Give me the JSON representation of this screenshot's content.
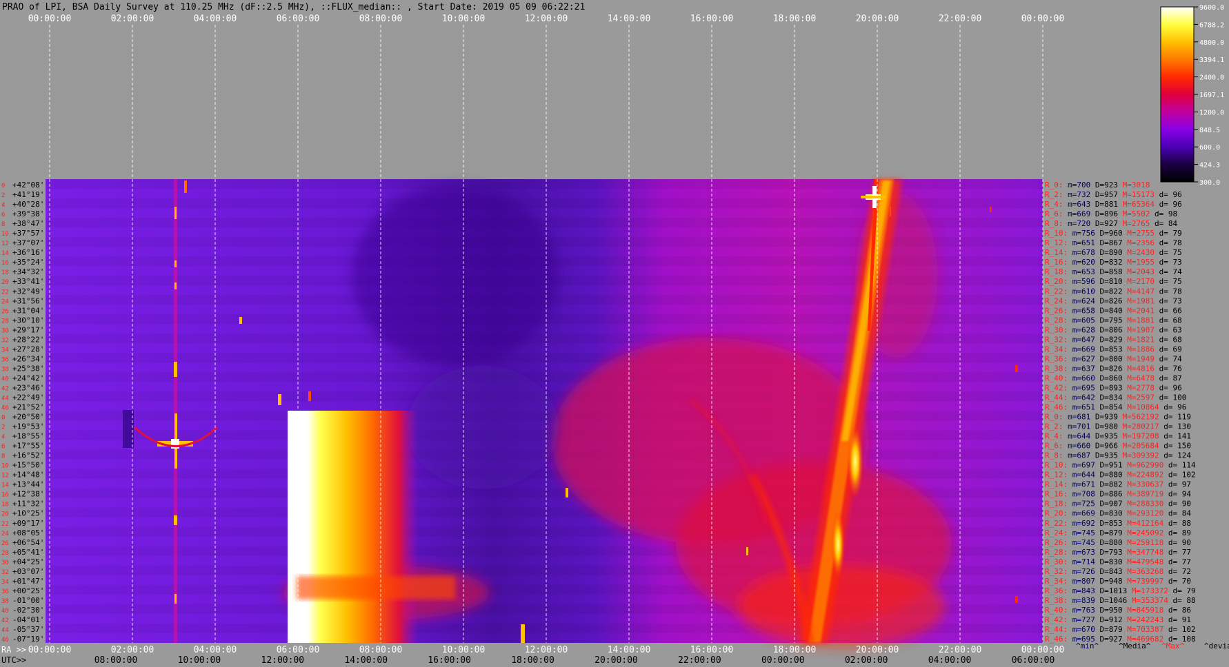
{
  "title": "PRAO of LPI, BSA Daily Survey at 110.25 MHz (dF::2.5 MHz), ::FLUX_median:: , Start Date: 2019 05 09 06:22:21",
  "chart_data": {
    "type": "heatmap",
    "title": "PRAO of LPI, BSA Daily Survey at 110.25 MHz (dF::2.5 MHz), ::FLUX_median:: , Start Date: 2019 05 09 06:22:21",
    "top_axis_ticks": [
      "00:00:00",
      "02:00:00",
      "04:00:00",
      "06:00:00",
      "08:00:00",
      "10:00:00",
      "12:00:00",
      "14:00:00",
      "16:00:00",
      "18:00:00",
      "20:00:00",
      "22:00:00",
      "00:00:00"
    ],
    "ra_axis_label": "RA >>",
    "ra_ticks": [
      "00:00:00",
      "02:00:00",
      "04:00:00",
      "06:00:00",
      "08:00:00",
      "10:00:00",
      "12:00:00",
      "14:00:00",
      "16:00:00",
      "18:00:00",
      "20:00:00",
      "22:00:00",
      "00:00:00"
    ],
    "utc_axis_label": "UTC>>",
    "utc_ticks": [
      "08:00:00",
      "10:00:00",
      "12:00:00",
      "14:00:00",
      "16:00:00",
      "18:00:00",
      "20:00:00",
      "22:00:00",
      "00:00:00",
      "02:00:00",
      "04:00:00",
      "06:00:00"
    ],
    "colorbar": {
      "ticks": [
        "9600.0",
        "6788.2",
        "4800.0",
        "3394.1",
        "2400.0",
        "1697.1",
        "1200.0",
        "848.5",
        "600.0",
        "424.3",
        "300.0"
      ],
      "range": [
        300,
        9600
      ],
      "scale": "log",
      "colors": [
        "#000000",
        "#1a0040",
        "#4b00b4",
        "#8a00e6",
        "#c000a0",
        "#e0003c",
        "#ff2a00",
        "#ff7a00",
        "#ffc000",
        "#ffff40",
        "#ffffff"
      ]
    },
    "row_indices": [
      "0",
      "2",
      "4",
      "6",
      "8",
      "10",
      "12",
      "14",
      "16",
      "18",
      "20",
      "22",
      "24",
      "26",
      "28",
      "30",
      "32",
      "34",
      "36",
      "38",
      "40",
      "42",
      "44",
      "46",
      "0",
      "2",
      "4",
      "6",
      "8",
      "10",
      "12",
      "14",
      "16",
      "18",
      "20",
      "22",
      "24",
      "26",
      "28",
      "30",
      "32",
      "34",
      "36",
      "38",
      "40",
      "42",
      "44",
      "46"
    ],
    "declinations": [
      "+42°08'",
      "+41°19'",
      "+40°28'",
      "+39°38'",
      "+38°47'",
      "+37°57'",
      "+37°07'",
      "+36°16'",
      "+35°24'",
      "+34°32'",
      "+33°41'",
      "+32°49'",
      "+31°56'",
      "+31°04'",
      "+30°10'",
      "+29°17'",
      "+28°22'",
      "+27°28'",
      "+26°34'",
      "+25°38'",
      "+24°42'",
      "+23°46'",
      "+22°49'",
      "+21°52'",
      "+20°50'",
      "+19°53'",
      "+18°55'",
      "+17°55'",
      "+16°52'",
      "+15°50'",
      "+14°48'",
      "+13°44'",
      "+12°38'",
      "+11°32'",
      "+10°25'",
      "+09°17'",
      "+08°05'",
      "+06°54'",
      "+05°41'",
      "+04°25'",
      "+03°07'",
      "+01°47'",
      "+00°25'",
      "-01°00'",
      "-02°30'",
      "-04°01'",
      "-05°37'",
      "-07°19'"
    ],
    "beam_stats": [
      {
        "beam": "R_0:",
        "m": "700",
        "D": "923",
        "M": "3018",
        "d": ""
      },
      {
        "beam": "R_2:",
        "m": "732",
        "D": "957",
        "M": "15173",
        "d": "96"
      },
      {
        "beam": "R_4:",
        "m": "643",
        "D": "881",
        "M": "65364",
        "d": "96"
      },
      {
        "beam": "R_6:",
        "m": "669",
        "D": "896",
        "M": "5502",
        "d": "98"
      },
      {
        "beam": "R_8:",
        "m": "720",
        "D": "927",
        "M": "2765",
        "d": "84"
      },
      {
        "beam": "R_10:",
        "m": "756",
        "D": "960",
        "M": "2755",
        "d": "79"
      },
      {
        "beam": "R_12:",
        "m": "651",
        "D": "867",
        "M": "2356",
        "d": "78"
      },
      {
        "beam": "R_14:",
        "m": "678",
        "D": "890",
        "M": "2430",
        "d": "75"
      },
      {
        "beam": "R_16:",
        "m": "620",
        "D": "832",
        "M": "1955",
        "d": "73"
      },
      {
        "beam": "R_18:",
        "m": "653",
        "D": "858",
        "M": "2043",
        "d": "74"
      },
      {
        "beam": "R_20:",
        "m": "596",
        "D": "810",
        "M": "2170",
        "d": "75"
      },
      {
        "beam": "R_22:",
        "m": "610",
        "D": "822",
        "M": "4147",
        "d": "78"
      },
      {
        "beam": "R_24:",
        "m": "624",
        "D": "826",
        "M": "1981",
        "d": "73"
      },
      {
        "beam": "R_26:",
        "m": "658",
        "D": "840",
        "M": "2041",
        "d": "66"
      },
      {
        "beam": "R_28:",
        "m": "605",
        "D": "795",
        "M": "1881",
        "d": "68"
      },
      {
        "beam": "R_30:",
        "m": "628",
        "D": "806",
        "M": "1907",
        "d": "63"
      },
      {
        "beam": "R_32:",
        "m": "647",
        "D": "829",
        "M": "1821",
        "d": "68"
      },
      {
        "beam": "R_34:",
        "m": "669",
        "D": "853",
        "M": "1886",
        "d": "69"
      },
      {
        "beam": "R_36:",
        "m": "627",
        "D": "800",
        "M": "1949",
        "d": "74"
      },
      {
        "beam": "R_38:",
        "m": "637",
        "D": "826",
        "M": "4816",
        "d": "76"
      },
      {
        "beam": "R_40:",
        "m": "660",
        "D": "860",
        "M": "6478",
        "d": "87"
      },
      {
        "beam": "R_42:",
        "m": "695",
        "D": "893",
        "M": "2778",
        "d": "96"
      },
      {
        "beam": "R_44:",
        "m": "642",
        "D": "834",
        "M": "2597",
        "d": "100"
      },
      {
        "beam": "R_46:",
        "m": "651",
        "D": "854",
        "M": "10864",
        "d": "96"
      },
      {
        "beam": "R_0:",
        "m": "681",
        "D": "939",
        "M": "562192",
        "d": "119"
      },
      {
        "beam": "R_2:",
        "m": "701",
        "D": "980",
        "M": "280217",
        "d": "130"
      },
      {
        "beam": "R_4:",
        "m": "644",
        "D": "935",
        "M": "197208",
        "d": "141"
      },
      {
        "beam": "R_6:",
        "m": "660",
        "D": "966",
        "M": "205684",
        "d": "150"
      },
      {
        "beam": "R_8:",
        "m": "687",
        "D": "935",
        "M": "309392",
        "d": "124"
      },
      {
        "beam": "R_10:",
        "m": "697",
        "D": "951",
        "M": "962990",
        "d": "114"
      },
      {
        "beam": "R_12:",
        "m": "644",
        "D": "880",
        "M": "224892",
        "d": "102"
      },
      {
        "beam": "R_14:",
        "m": "671",
        "D": "882",
        "M": "330637",
        "d": "97"
      },
      {
        "beam": "R_16:",
        "m": "708",
        "D": "886",
        "M": "389719",
        "d": "94"
      },
      {
        "beam": "R_18:",
        "m": "725",
        "D": "907",
        "M": "288330",
        "d": "90"
      },
      {
        "beam": "R_20:",
        "m": "669",
        "D": "830",
        "M": "293120",
        "d": "84"
      },
      {
        "beam": "R_22:",
        "m": "692",
        "D": "853",
        "M": "412164",
        "d": "88"
      },
      {
        "beam": "R_24:",
        "m": "745",
        "D": "879",
        "M": "245092",
        "d": "89"
      },
      {
        "beam": "R_26:",
        "m": "745",
        "D": "880",
        "M": "259118",
        "d": "90"
      },
      {
        "beam": "R_28:",
        "m": "673",
        "D": "793",
        "M": "347748",
        "d": "77"
      },
      {
        "beam": "R_30:",
        "m": "714",
        "D": "830",
        "M": "479548",
        "d": "77"
      },
      {
        "beam": "R_32:",
        "m": "726",
        "D": "843",
        "M": "363268",
        "d": "72"
      },
      {
        "beam": "R_34:",
        "m": "807",
        "D": "948",
        "M": "739997",
        "d": "70"
      },
      {
        "beam": "R_36:",
        "m": "843",
        "D": "1013",
        "M": "173372",
        "d": "79"
      },
      {
        "beam": "R_38:",
        "m": "839",
        "D": "1046",
        "M": "353374",
        "d": "88"
      },
      {
        "beam": "R_40:",
        "m": "763",
        "D": "950",
        "M": "845918",
        "d": "86"
      },
      {
        "beam": "R_42:",
        "m": "727",
        "D": "912",
        "M": "242243",
        "d": "91"
      },
      {
        "beam": "R_44:",
        "m": "670",
        "D": "879",
        "M": "703387",
        "d": "102"
      },
      {
        "beam": "R_46:",
        "m": "695",
        "D": "927",
        "M": "469682",
        "d": "108"
      }
    ],
    "stats_legend": [
      "^min^",
      "^Media^",
      "^Max^",
      "^devia^"
    ],
    "grid": true
  }
}
